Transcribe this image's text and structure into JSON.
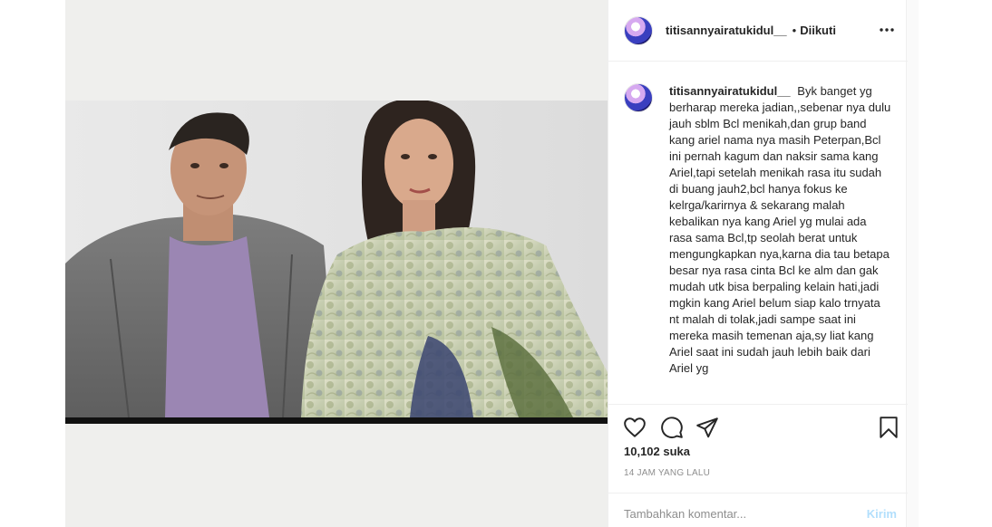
{
  "post": {
    "username": "titisannyairatukidul__",
    "follow_dot": "•",
    "follow_label": "Diikuti",
    "more_icon_label": "•••",
    "caption_username": "titisannyairatukidul__",
    "caption_text": "Byk banget yg berharap mereka jadian,,sebenar nya dulu jauh sblm Bcl menikah,dan grup band kang ariel nama nya masih Peterpan,Bcl ini pernah kagum dan naksir sama kang Ariel,tapi setelah menikah rasa itu sudah di buang jauh2,bcl hanya fokus ke kelrga/karirnya & sekarang malah kebalikan nya kang Ariel yg mulai ada rasa sama Bcl,tp seolah berat untuk mengungkapkan nya,karna dia tau betapa besar nya rasa cinta Bcl ke alm dan gak mudah utk bisa berpaling kelain hati,jadi mgkin kang Ariel belum siap kalo trnyata nt malah di tolak,jadi sampe saat ini mereka masih temenan aja,sy liat kang Ariel saat ini sudah jauh lebih baik dari Ariel yg",
    "likes": "10,102 suka",
    "time": "14 JAM YANG LALU"
  },
  "comment": {
    "placeholder": "Tambahkan komentar...",
    "post_label": "Kirim"
  },
  "icons": {
    "like": "heart-icon",
    "comment": "comment-icon",
    "share": "share-icon",
    "save": "bookmark-icon",
    "more": "more-icon"
  },
  "colors": {
    "text": "#262626",
    "muted": "#8e8e8e",
    "post_button_disabled": "#b2dffc",
    "border": "#efefef",
    "photo_backdrop": "#efefed"
  }
}
